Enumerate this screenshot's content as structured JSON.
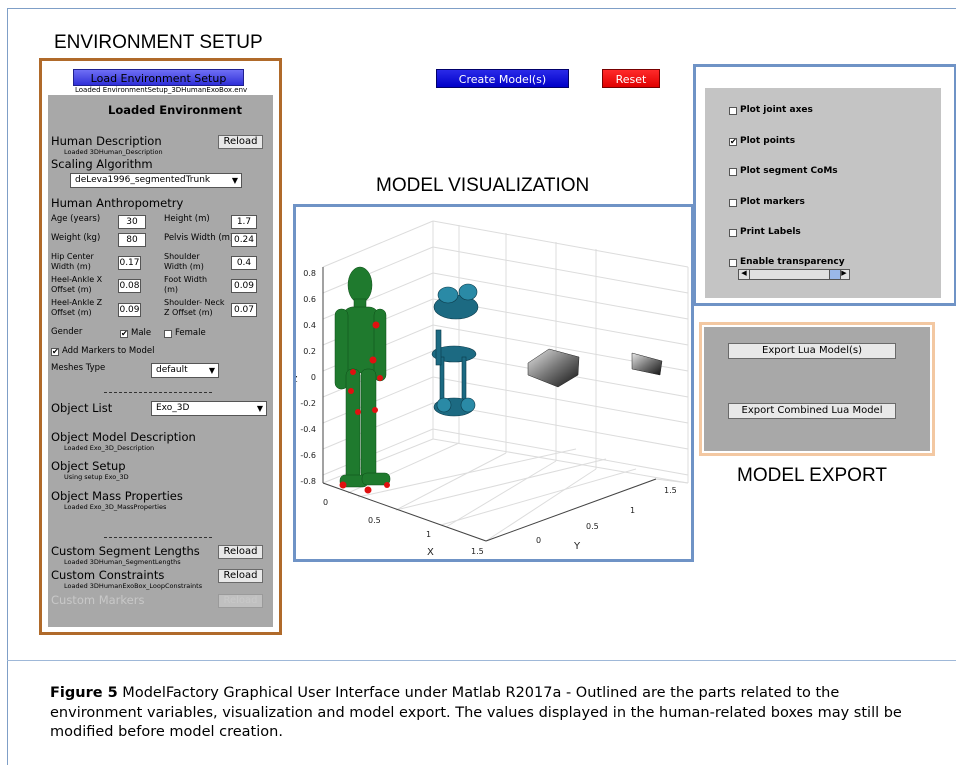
{
  "headings": {
    "environment": "ENVIRONMENT SETUP",
    "visualization": "MODEL VISUALIZATION",
    "export": "MODEL EXPORT"
  },
  "toolbar": {
    "load_label": "Load Environment Setup",
    "load_status": "Loaded EnvironmentSetup_3DHumanExoBox.env",
    "create_label": "Create Model(s)",
    "reset_label": "Reset"
  },
  "env": {
    "title": "Loaded Environment",
    "human_description": "Human Description",
    "human_description_status": "Loaded 3DHuman_Description",
    "reload": "Reload",
    "scaling_label": "Scaling Algorithm",
    "scaling_value": "deLeva1996_segmentedTrunk",
    "anthropometry": "Human Anthropometry",
    "age_label": "Age (years)",
    "age_value": "30",
    "height_label": "Height (m)",
    "height_value": "1.7",
    "weight_label": "Weight (kg)",
    "weight_value": "80",
    "pelvis_label": "Pelvis Width (m)",
    "pelvis_value": "0.24",
    "hip_label_1": "Hip Center",
    "hip_label_2": "Width (m)",
    "hip_value": "0.17",
    "shoulder_label_1": "Shoulder",
    "shoulder_label_2": "Width (m)",
    "shoulder_value": "0.4",
    "heelx_label_1": "Heel-Ankle X",
    "heelx_label_2": "Offset (m)",
    "heelx_value": "0.08",
    "foot_label_1": "Foot Width",
    "foot_label_2": "(m)",
    "foot_value": "0.09",
    "heelz_label_1": "Heel-Ankle Z",
    "heelz_label_2": "Offset (m)",
    "heelz_value": "0.09",
    "neck_label_1": "Shoulder- Neck",
    "neck_label_2": "Z Offset (m)",
    "neck_value": "0.07",
    "gender_label": "Gender",
    "male": "Male",
    "female": "Female",
    "add_markers": "Add Markers to Model",
    "meshes_label": "Meshes Type",
    "meshes_value": "default",
    "object_list_label": "Object List",
    "object_list_value": "Exo_3D",
    "object_model_desc": "Object Model Description",
    "object_model_desc_status": "Loaded Exo_3D_Description",
    "object_setup": "Object Setup",
    "object_setup_status": "Using setup Exo_3D",
    "object_mass": "Object Mass Properties",
    "object_mass_status": "Loaded Exo_3D_MassProperties",
    "custom_segments": "Custom Segment Lengths",
    "custom_segments_status": "Loaded 3DHuman_SegmentLengths",
    "custom_constraints": "Custom Constraints",
    "custom_constraints_status": "Loaded 3DHumanExoBox_LoopConstraints",
    "custom_markers": "Custom Markers"
  },
  "options": {
    "joint_axes": "Plot joint axes",
    "points": "Plot points",
    "segment_coms": "Plot segment CoMs",
    "markers": "Plot markers",
    "print_labels": "Print Labels",
    "transparency": "Enable transparency"
  },
  "export": {
    "lua_models": "Export Lua Model(s)",
    "combined": "Export Combined Lua Model"
  },
  "plot": {
    "z_ticks": [
      "0.8",
      "0.6",
      "0.4",
      "0.2",
      "0",
      "-0.2",
      "-0.4",
      "-0.6",
      "-0.8"
    ],
    "x_ticks": [
      "0",
      "0.5",
      "1",
      "1.5"
    ],
    "y_ticks": [
      "0",
      "0.5",
      "1",
      "1.5"
    ],
    "x_label": "X",
    "y_label": "Y",
    "z_label": "Z"
  },
  "caption": {
    "bold": "Figure 5",
    "text": " ModelFactory Graphical User Interface under Matlab R2017a - Outlined are the parts related to the environment variables, visualization and model export. The values displayed in the human-related boxes may still be modified before model creation."
  }
}
